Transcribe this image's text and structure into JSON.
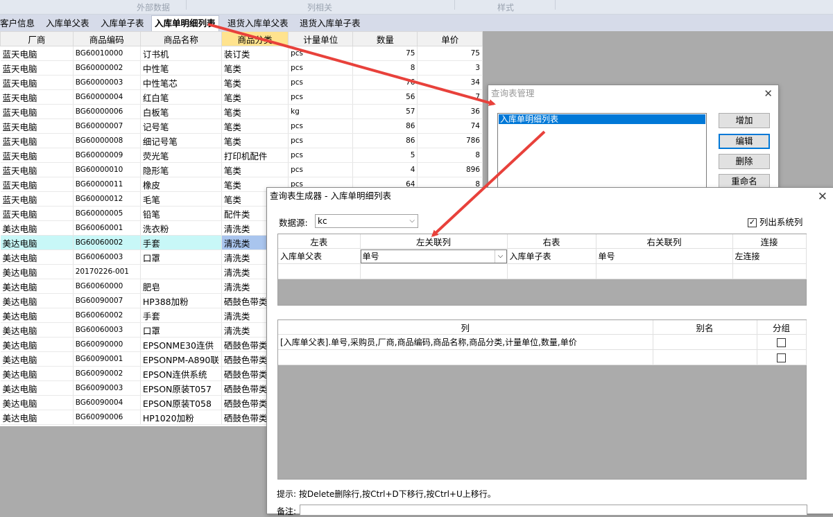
{
  "ribbon": {
    "groups": [
      "外部数据",
      "列相关",
      "样式"
    ]
  },
  "tabs": [
    "客户信息",
    "入库单父表",
    "入库单子表",
    "入库单明细列表",
    "退货入库单父表",
    "退货入库单子表"
  ],
  "active_tab": "入库单明细列表",
  "grid": {
    "columns": [
      "厂商",
      "商品编码",
      "商品名称",
      "商品分类",
      "计量单位",
      "数量",
      "单价"
    ],
    "highlighted_column": "商品分类",
    "selected_row_index": 13,
    "rows": [
      [
        "蓝天电脑",
        "BG60010000",
        "订书机",
        "装订类",
        "pcs",
        "75",
        "75"
      ],
      [
        "蓝天电脑",
        "BG60000002",
        "中性笔",
        "笔类",
        "pcs",
        "8",
        "3"
      ],
      [
        "蓝天电脑",
        "BG60000003",
        "中性笔芯",
        "笔类",
        "pcs",
        "76",
        "34"
      ],
      [
        "蓝天电脑",
        "BG60000004",
        "红白笔",
        "笔类",
        "pcs",
        "56",
        "7"
      ],
      [
        "蓝天电脑",
        "BG60000006",
        "白板笔",
        "笔类",
        "kg",
        "57",
        "36"
      ],
      [
        "蓝天电脑",
        "BG60000007",
        "记号笔",
        "笔类",
        "pcs",
        "86",
        "74"
      ],
      [
        "蓝天电脑",
        "BG60000008",
        "细记号笔",
        "笔类",
        "pcs",
        "86",
        "786"
      ],
      [
        "蓝天电脑",
        "BG60000009",
        "荧光笔",
        "打印机配件",
        "pcs",
        "5",
        "8"
      ],
      [
        "蓝天电脑",
        "BG60000010",
        "隐形笔",
        "笔类",
        "pcs",
        "4",
        "896"
      ],
      [
        "蓝天电脑",
        "BG60000011",
        "橡皮",
        "笔类",
        "pcs",
        "64",
        "8"
      ],
      [
        "蓝天电脑",
        "BG60000012",
        "毛笔",
        "笔类",
        "",
        "",
        ""
      ],
      [
        "蓝天电脑",
        "BG60000005",
        "铅笔",
        "配件类",
        "",
        "",
        ""
      ],
      [
        "美达电脑",
        "BG60060001",
        "洗衣粉",
        "清洗类",
        "",
        "",
        ""
      ],
      [
        "美达电脑",
        "BG60060002",
        "手套",
        "清洗类",
        "",
        "",
        ""
      ],
      [
        "美达电脑",
        "BG60060003",
        "口罩",
        "清洗类",
        "",
        "",
        ""
      ],
      [
        "美达电脑",
        "20170226-001",
        "",
        "清洗类",
        "",
        "",
        ""
      ],
      [
        "美达电脑",
        "BG60060000",
        "肥皂",
        "清洗类",
        "",
        "",
        ""
      ],
      [
        "美达电脑",
        "BG60090007",
        "HP388加粉",
        "硒鼓色带类",
        "",
        "",
        ""
      ],
      [
        "美达电脑",
        "BG60060002",
        "手套",
        "清洗类",
        "",
        "",
        ""
      ],
      [
        "美达电脑",
        "BG60060003",
        "口罩",
        "清洗类",
        "",
        "",
        ""
      ],
      [
        "美达电脑",
        "BG60090000",
        "EPSONME30连供",
        "硒鼓色带类",
        "",
        "",
        ""
      ],
      [
        "美达电脑",
        "BG60090001",
        "EPSONPM-A890联",
        "硒鼓色带类",
        "",
        "",
        ""
      ],
      [
        "美达电脑",
        "BG60090002",
        "EPSON连供系统",
        "硒鼓色带类",
        "",
        "",
        ""
      ],
      [
        "美达电脑",
        "BG60090003",
        "EPSON原装T057",
        "硒鼓色带类",
        "",
        "",
        ""
      ],
      [
        "美达电脑",
        "BG60090004",
        "EPSON原装T058",
        "硒鼓色带类",
        "",
        "",
        ""
      ],
      [
        "美达电脑",
        "BG60090006",
        "HP1020加粉",
        "硒鼓色带类",
        "",
        "",
        ""
      ]
    ]
  },
  "query_manager": {
    "title": "查询表管理",
    "list_items": [
      "入库单明细列表"
    ],
    "buttons": {
      "add": "增加",
      "edit": "编辑",
      "delete": "删除",
      "rename": "重命名"
    }
  },
  "query_builder": {
    "title": "查询表生成器 - 入库单明细列表",
    "datasource_label": "数据源:",
    "datasource_value": "kc",
    "show_system_columns_label": "列出系统列",
    "show_system_columns_checked": true,
    "join_columns": [
      "左表",
      "左关联列",
      "右表",
      "右关联列",
      "连接"
    ],
    "join_rows": [
      [
        "入库单父表",
        "单号",
        "入库单子表",
        "单号",
        "左连接"
      ]
    ],
    "col_columns": [
      "列",
      "别名",
      "分组"
    ],
    "col_rows": [
      {
        "expr": "[入库单父表].单号,采购员,厂商,商品编码,商品名称,商品分类,计量单位,数量,单价",
        "alias": "",
        "group": false
      },
      {
        "expr": "",
        "alias": "",
        "group": false
      }
    ],
    "hint": "提示: 按Delete删除行,按Ctrl+D下移行,按Ctrl+U上移行。",
    "remark_label": "备注:"
  },
  "colors": {
    "arrow": "#e8413b",
    "selection": "#0078d7",
    "highlight_header": "#ffe38e"
  }
}
